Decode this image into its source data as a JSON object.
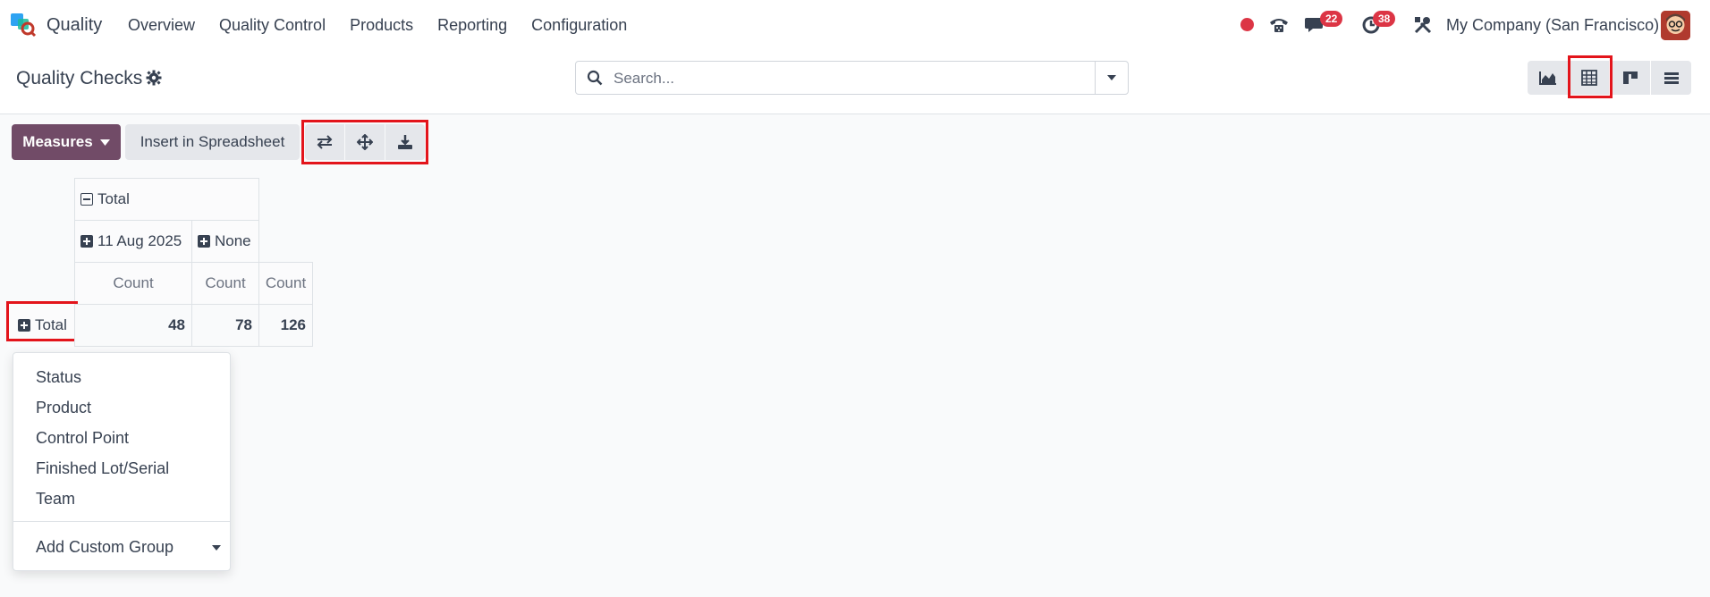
{
  "navbar": {
    "app_name": "Quality",
    "menu": [
      "Overview",
      "Quality Control",
      "Products",
      "Reporting",
      "Configuration"
    ],
    "messages_badge": "22",
    "activities_badge": "38",
    "company": "My Company (San Francisco)"
  },
  "control_panel": {
    "title": "Quality Checks",
    "search_placeholder": "Search..."
  },
  "toolbar": {
    "measures_label": "Measures",
    "spreadsheet_label": "Insert in Spreadsheet"
  },
  "pivot": {
    "col_header_total": "Total",
    "col_groups": [
      "11 Aug 2025",
      "None"
    ],
    "measure_label": "Count",
    "row_header_total": "Total",
    "values": [
      "48",
      "78",
      "126"
    ]
  },
  "group_dropdown": {
    "items": [
      "Status",
      "Product",
      "Control Point",
      "Finished Lot/Serial",
      "Team"
    ],
    "custom_group_label": "Add Custom Group"
  },
  "colors": {
    "primary": "#714b67",
    "highlight": "#e3141b",
    "badge": "#dc3545"
  }
}
